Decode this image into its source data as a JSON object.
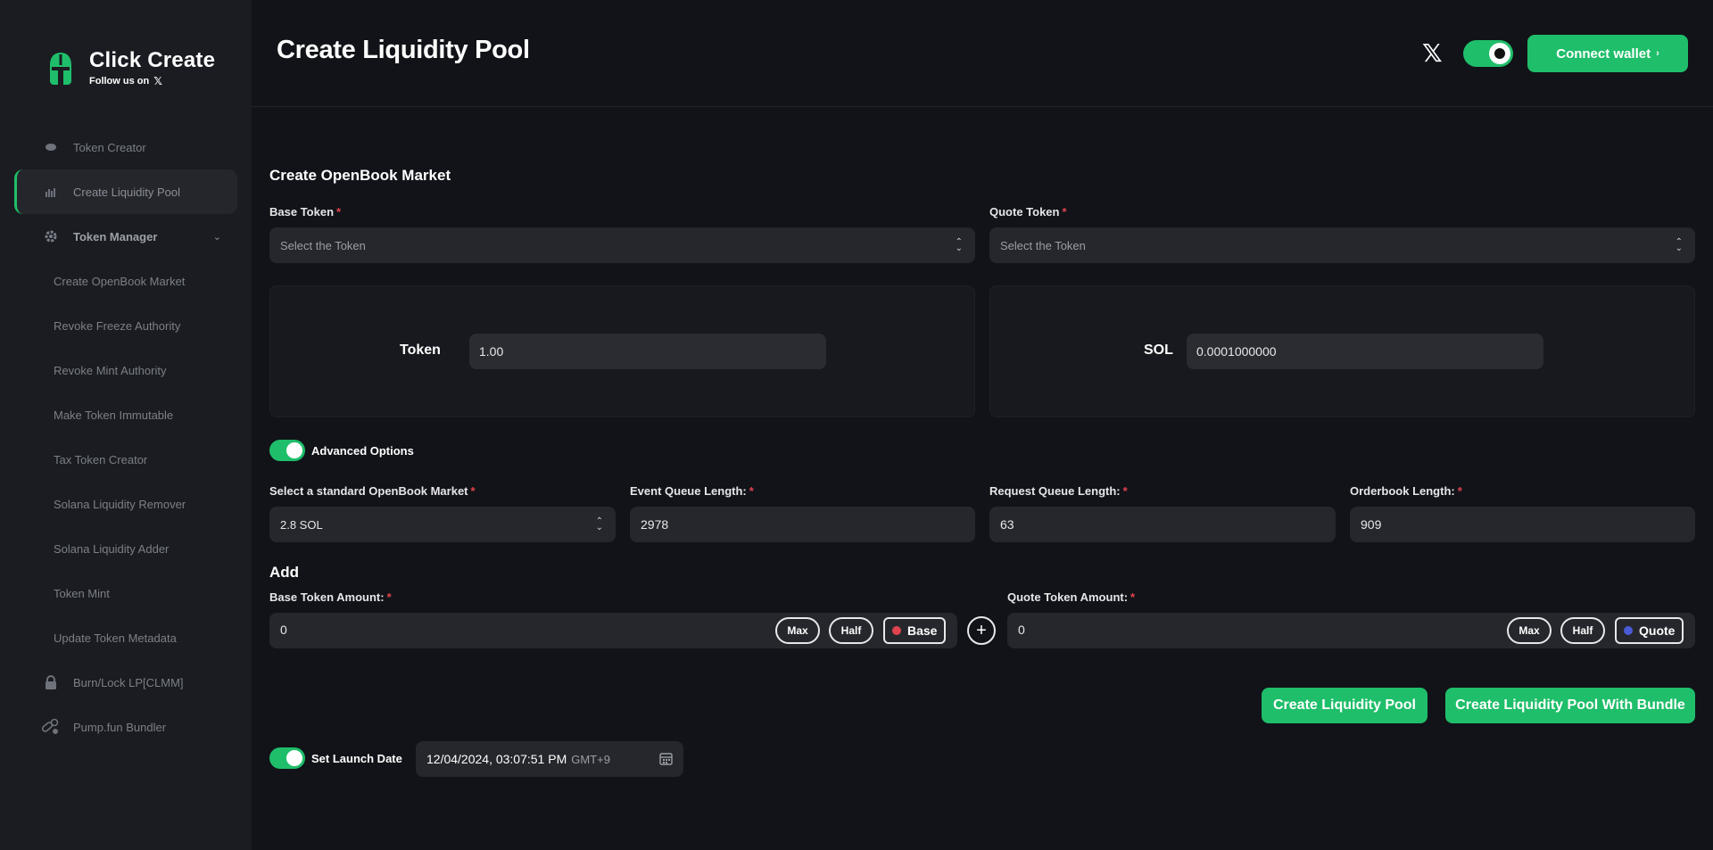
{
  "brand": {
    "title": "Click Create",
    "follow_text": "Follow us on",
    "x_glyph": "𝕏"
  },
  "sidebar": {
    "items": [
      {
        "label": "Token Creator",
        "icon": "coin-icon"
      },
      {
        "label": "Create Liquidity Pool",
        "icon": "bar-chart-icon",
        "active": true
      },
      {
        "label": "Token Manager",
        "icon": "gear-icon",
        "expanded": true
      },
      {
        "label": "Create OpenBook Market"
      },
      {
        "label": "Revoke Freeze Authority"
      },
      {
        "label": "Revoke Mint Authority"
      },
      {
        "label": "Make Token Immutable"
      },
      {
        "label": "Tax Token Creator"
      },
      {
        "label": "Solana Liquidity Remover"
      },
      {
        "label": "Solana Liquidity Adder"
      },
      {
        "label": "Token Mint"
      },
      {
        "label": "Update Token Metadata"
      },
      {
        "label": "Burn/Lock LP[CLMM]",
        "icon": "lock-icon"
      },
      {
        "label": "Pump.fun Bundler",
        "icon": "pills-icon"
      }
    ]
  },
  "header": {
    "title": "Create Liquidity Pool",
    "x_glyph": "𝕏",
    "connect_label": "Connect wallet",
    "connect_arrow": "›"
  },
  "market": {
    "section_title": "Create OpenBook Market",
    "base_label": "Base Token",
    "quote_label": "Quote Token",
    "required_mark": "*",
    "base_placeholder": "Select the Token",
    "quote_placeholder": "Select the Token",
    "base_panel_label": "Token",
    "base_panel_value": "1.00",
    "quote_panel_label": "SOL",
    "quote_panel_value": "0.0001000000"
  },
  "advanced": {
    "toggle_label": "Advanced Options",
    "enabled": true,
    "market_label": "Select a standard OpenBook Market",
    "market_value": "2.8 SOL",
    "event_label": "Event Queue Length:",
    "event_value": "2978",
    "request_label": "Request Queue Length:",
    "request_value": "63",
    "orderbook_label": "Orderbook Length:",
    "orderbook_value": "909"
  },
  "add": {
    "section_title": "Add",
    "base_amount_label": "Base Token Amount:",
    "base_amount_value": "0",
    "quote_amount_label": "Quote Token Amount:",
    "quote_amount_value": "0",
    "max_label": "Max",
    "half_label": "Half",
    "base_tag": "Base",
    "quote_tag": "Quote",
    "plus_glyph": "+"
  },
  "actions": {
    "create_label": "Create Liquidity Pool",
    "bundle_label": "Create Liquidity Pool With Bundle"
  },
  "launch": {
    "toggle_label": "Set Launch Date",
    "enabled": true,
    "date_value": "12/04/2024, 03:07:51 PM",
    "timezone": "GMT+9"
  },
  "colors": {
    "accent": "#1fbe6a",
    "background": "#111318",
    "sidebar": "#1a1c21",
    "base_dot": "#e0434e",
    "quote_dot": "#4b5bd6"
  }
}
